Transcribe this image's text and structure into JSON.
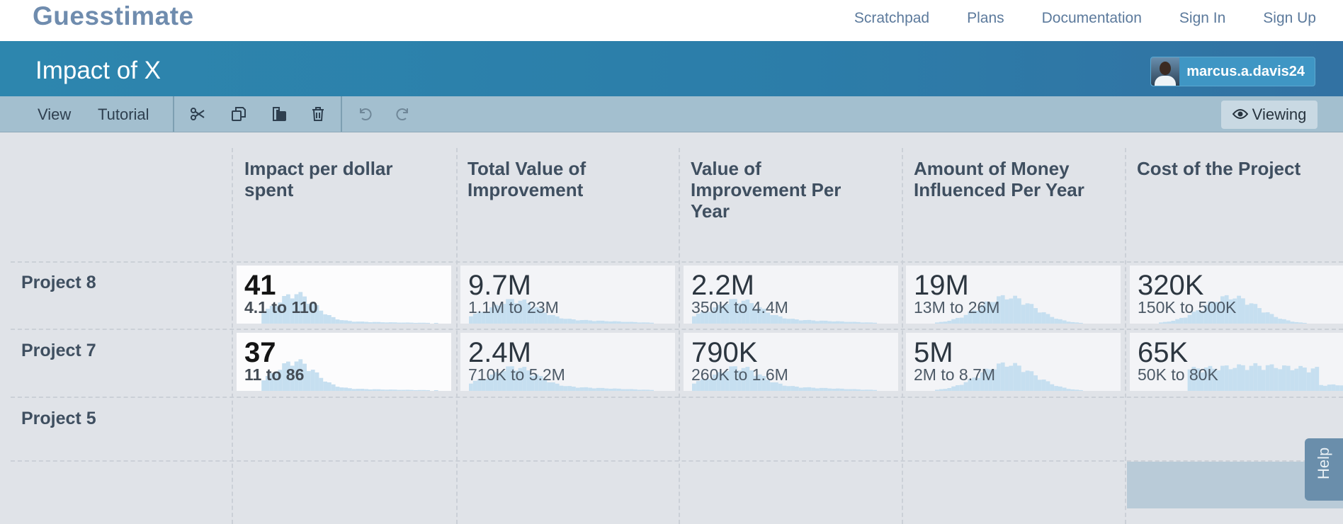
{
  "nav": {
    "logo": "Guesstimate",
    "links": [
      "Scratchpad",
      "Plans",
      "Documentation",
      "Sign In",
      "Sign Up"
    ]
  },
  "header": {
    "title": "Impact of X",
    "username": "marcus.a.davis24"
  },
  "toolbar": {
    "view_label": "View",
    "tutorial_label": "Tutorial",
    "icons": [
      "scissors-icon",
      "copy-icon",
      "paste-icon",
      "trash-icon",
      "undo-icon",
      "redo-icon"
    ],
    "viewing_label": "Viewing"
  },
  "grid": {
    "columns": [
      "Impact per dollar spent",
      "Total Value of Improvement",
      "Value of Improvement Per Year",
      "Amount of Money Influenced Per Year",
      "Cost of the Project"
    ],
    "rows": [
      {
        "label": "Project 8",
        "cells": [
          {
            "mean": "41",
            "range": "4.1 to 110"
          },
          {
            "mean": "9.7M",
            "range": "1.1M to 23M"
          },
          {
            "mean": "2.2M",
            "range": "350K to 4.4M"
          },
          {
            "mean": "19M",
            "range": "13M to 26M"
          },
          {
            "mean": "320K",
            "range": "150K to 500K"
          }
        ]
      },
      {
        "label": "Project 7",
        "cells": [
          {
            "mean": "37",
            "range": "11 to 86"
          },
          {
            "mean": "2.4M",
            "range": "710K to 5.2M"
          },
          {
            "mean": "790K",
            "range": "260K to 1.6M"
          },
          {
            "mean": "5M",
            "range": "2M to 8.7M"
          },
          {
            "mean": "65K",
            "range": "50K to 80K"
          }
        ]
      },
      {
        "label": "Project 5",
        "cells": []
      }
    ]
  },
  "help_label": "Help",
  "colors": {
    "header_blue": "#2c7da9",
    "toolbar": "#a3bfcf",
    "histogram": "#c6dff0",
    "background": "#e0e3e8"
  }
}
